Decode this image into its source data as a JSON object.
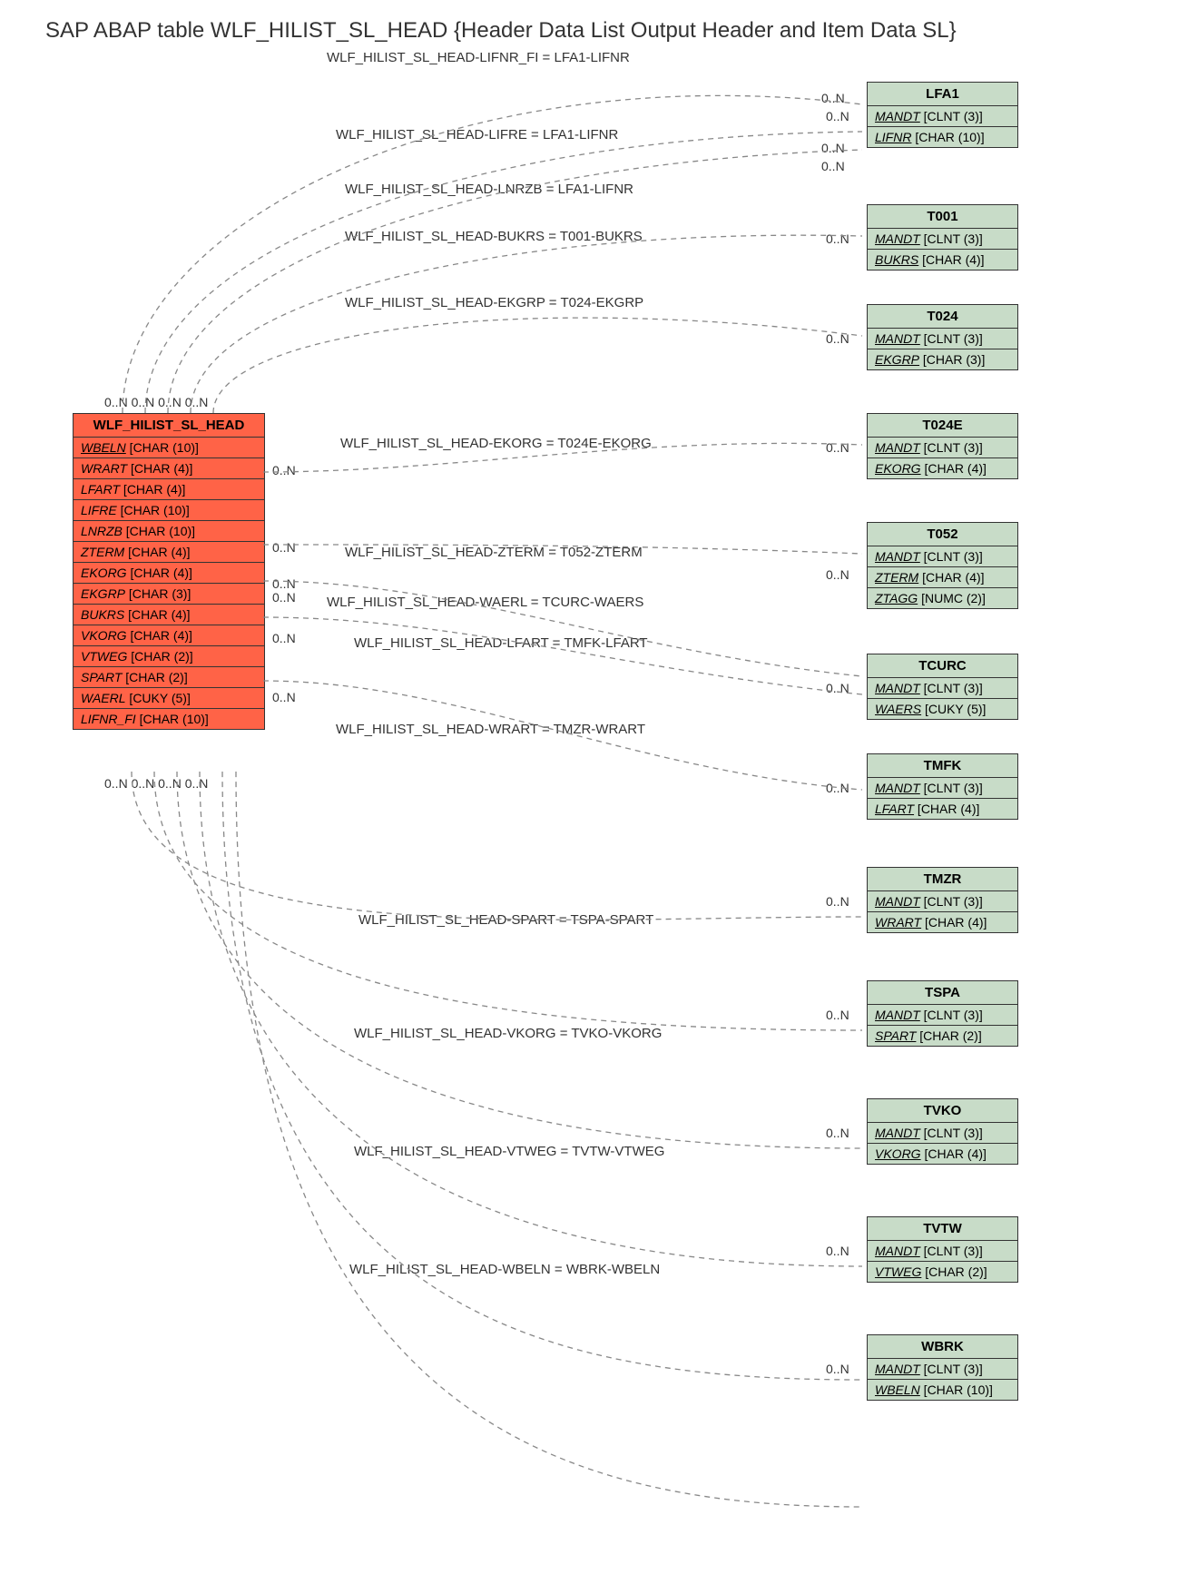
{
  "title": "SAP ABAP table WLF_HILIST_SL_HEAD {Header Data List Output Header and Item Data SL}",
  "main": {
    "name": "WLF_HILIST_SL_HEAD",
    "fields": [
      {
        "name": "WBELN",
        "type": "[CHAR (10)]",
        "key": true
      },
      {
        "name": "WRART",
        "type": "[CHAR (4)]",
        "key": false
      },
      {
        "name": "LFART",
        "type": "[CHAR (4)]",
        "key": false
      },
      {
        "name": "LIFRE",
        "type": "[CHAR (10)]",
        "key": false
      },
      {
        "name": "LNRZB",
        "type": "[CHAR (10)]",
        "key": false
      },
      {
        "name": "ZTERM",
        "type": "[CHAR (4)]",
        "key": false
      },
      {
        "name": "EKORG",
        "type": "[CHAR (4)]",
        "key": false
      },
      {
        "name": "EKGRP",
        "type": "[CHAR (3)]",
        "key": false
      },
      {
        "name": "BUKRS",
        "type": "[CHAR (4)]",
        "key": false
      },
      {
        "name": "VKORG",
        "type": "[CHAR (4)]",
        "key": false
      },
      {
        "name": "VTWEG",
        "type": "[CHAR (2)]",
        "key": false
      },
      {
        "name": "SPART",
        "type": "[CHAR (2)]",
        "key": false
      },
      {
        "name": "WAERL",
        "type": "[CUKY (5)]",
        "key": false
      },
      {
        "name": "LIFNR_FI",
        "type": "[CHAR (10)]",
        "key": false
      }
    ]
  },
  "refs": [
    {
      "name": "LFA1",
      "fields": [
        {
          "name": "MANDT",
          "type": "[CLNT (3)]",
          "key": true
        },
        {
          "name": "LIFNR",
          "type": "[CHAR (10)]",
          "key": true
        }
      ]
    },
    {
      "name": "T001",
      "fields": [
        {
          "name": "MANDT",
          "type": "[CLNT (3)]",
          "key": true
        },
        {
          "name": "BUKRS",
          "type": "[CHAR (4)]",
          "key": true
        }
      ]
    },
    {
      "name": "T024",
      "fields": [
        {
          "name": "MANDT",
          "type": "[CLNT (3)]",
          "key": true
        },
        {
          "name": "EKGRP",
          "type": "[CHAR (3)]",
          "key": true
        }
      ]
    },
    {
      "name": "T024E",
      "fields": [
        {
          "name": "MANDT",
          "type": "[CLNT (3)]",
          "key": true
        },
        {
          "name": "EKORG",
          "type": "[CHAR (4)]",
          "key": true
        }
      ]
    },
    {
      "name": "T052",
      "fields": [
        {
          "name": "MANDT",
          "type": "[CLNT (3)]",
          "key": true
        },
        {
          "name": "ZTERM",
          "type": "[CHAR (4)]",
          "key": true
        },
        {
          "name": "ZTAGG",
          "type": "[NUMC (2)]",
          "key": true
        }
      ]
    },
    {
      "name": "TCURC",
      "fields": [
        {
          "name": "MANDT",
          "type": "[CLNT (3)]",
          "key": true
        },
        {
          "name": "WAERS",
          "type": "[CUKY (5)]",
          "key": true
        }
      ]
    },
    {
      "name": "TMFK",
      "fields": [
        {
          "name": "MANDT",
          "type": "[CLNT (3)]",
          "key": true
        },
        {
          "name": "LFART",
          "type": "[CHAR (4)]",
          "key": true
        }
      ]
    },
    {
      "name": "TMZR",
      "fields": [
        {
          "name": "MANDT",
          "type": "[CLNT (3)]",
          "key": true
        },
        {
          "name": "WRART",
          "type": "[CHAR (4)]",
          "key": true
        }
      ]
    },
    {
      "name": "TSPA",
      "fields": [
        {
          "name": "MANDT",
          "type": "[CLNT (3)]",
          "key": true
        },
        {
          "name": "SPART",
          "type": "[CHAR (2)]",
          "key": true
        }
      ]
    },
    {
      "name": "TVKO",
      "fields": [
        {
          "name": "MANDT",
          "type": "[CLNT (3)]",
          "key": true
        },
        {
          "name": "VKORG",
          "type": "[CHAR (4)]",
          "key": true
        }
      ]
    },
    {
      "name": "TVTW",
      "fields": [
        {
          "name": "MANDT",
          "type": "[CLNT (3)]",
          "key": true
        },
        {
          "name": "VTWEG",
          "type": "[CHAR (2)]",
          "key": true
        }
      ]
    },
    {
      "name": "WBRK",
      "fields": [
        {
          "name": "MANDT",
          "type": "[CLNT (3)]",
          "key": true
        },
        {
          "name": "WBELN",
          "type": "[CHAR (10)]",
          "key": true
        }
      ]
    }
  ],
  "rels": [
    {
      "label": "WLF_HILIST_SL_HEAD-LIFNR_FI = LFA1-LIFNR"
    },
    {
      "label": "WLF_HILIST_SL_HEAD-LIFRE = LFA1-LIFNR"
    },
    {
      "label": "WLF_HILIST_SL_HEAD-LNRZB = LFA1-LIFNR"
    },
    {
      "label": "WLF_HILIST_SL_HEAD-BUKRS = T001-BUKRS"
    },
    {
      "label": "WLF_HILIST_SL_HEAD-EKGRP = T024-EKGRP"
    },
    {
      "label": "WLF_HILIST_SL_HEAD-EKORG = T024E-EKORG"
    },
    {
      "label": "WLF_HILIST_SL_HEAD-ZTERM = T052-ZTERM"
    },
    {
      "label": "WLF_HILIST_SL_HEAD-WAERL = TCURC-WAERS"
    },
    {
      "label": "WLF_HILIST_SL_HEAD-LFART = TMFK-LFART"
    },
    {
      "label": "WLF_HILIST_SL_HEAD-WRART = TMZR-WRART"
    },
    {
      "label": "WLF_HILIST_SL_HEAD-SPART = TSPA-SPART"
    },
    {
      "label": "WLF_HILIST_SL_HEAD-VKORG = TVKO-VKORG"
    },
    {
      "label": "WLF_HILIST_SL_HEAD-VTWEG = TVTW-VTWEG"
    },
    {
      "label": "WLF_HILIST_SL_HEAD-WBELN = WBRK-WBELN"
    }
  ],
  "cards": {
    "zn": "0..N",
    "zn2": "0..N",
    "top_cluster": "0..N  0..N 0..N 0..N",
    "bot_cluster": "0..N 0..N 0..N 0..N"
  }
}
